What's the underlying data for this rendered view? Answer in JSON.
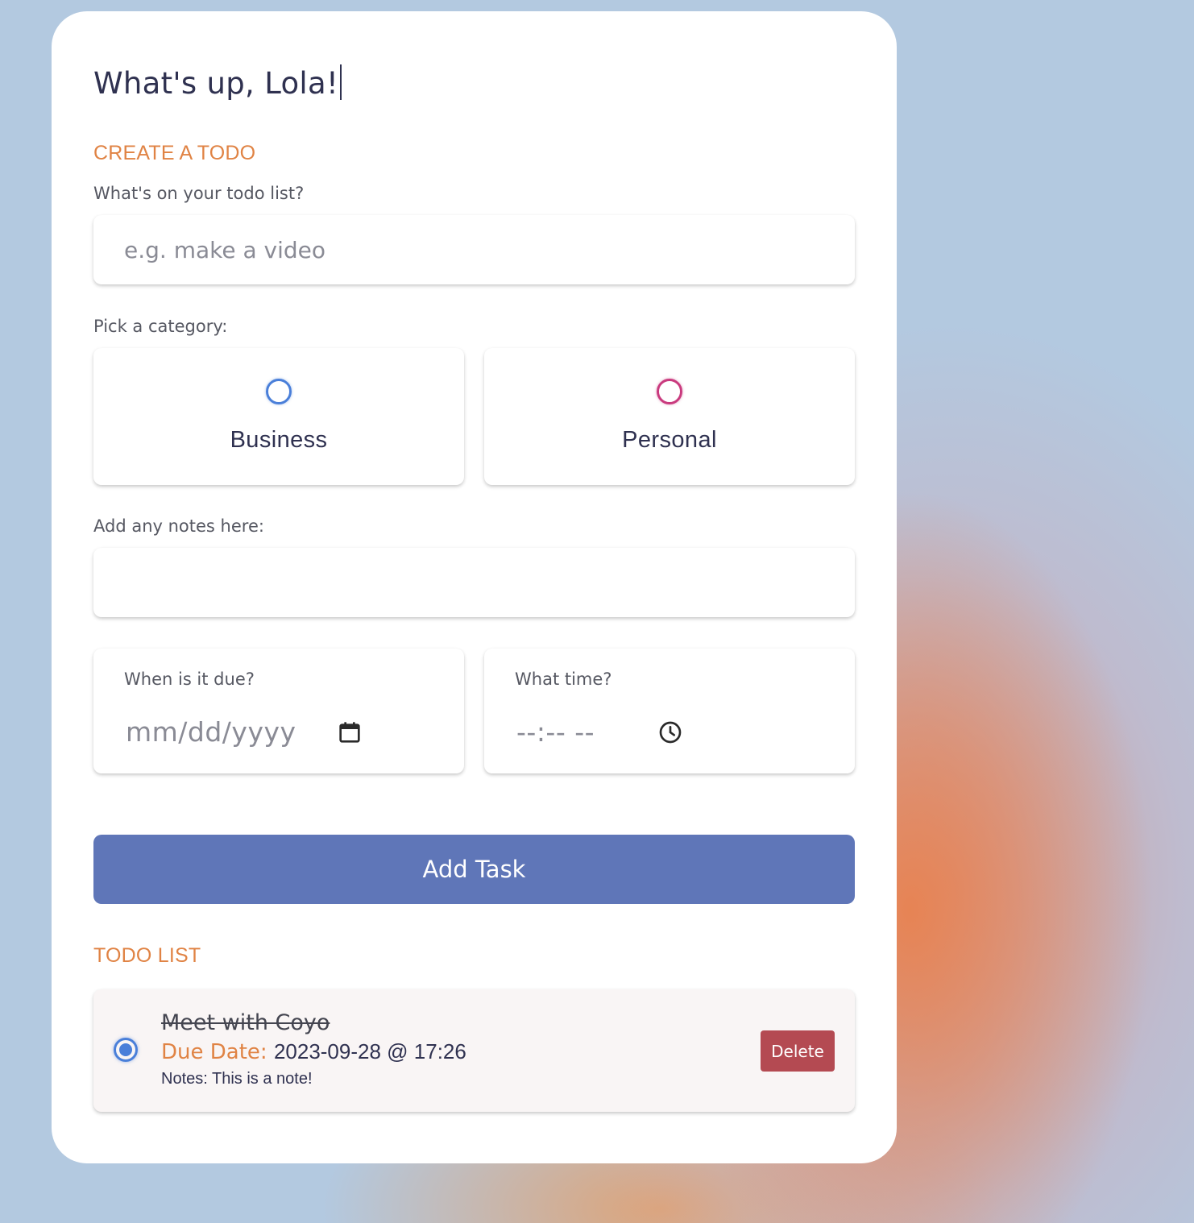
{
  "greeting": {
    "prefix": "What's up, ",
    "name": "Lola!"
  },
  "create": {
    "heading": "CREATE A TODO",
    "task_label": "What's on your todo list?",
    "task_placeholder": "e.g. make a video",
    "category_label": "Pick a category:",
    "categories": [
      {
        "label": "Business",
        "color": "#4a7fd9",
        "selected": false
      },
      {
        "label": "Personal",
        "color": "#c93a7e",
        "selected": false
      }
    ],
    "notes_label": "Add any notes here:",
    "notes_value": "",
    "date_label": "When is it due?",
    "date_value": "mm/dd/yyyy",
    "date_icon": "calendar-icon",
    "time_label": "What time?",
    "time_value": "--:-- --",
    "time_icon": "clock-icon",
    "submit_label": "Add Task"
  },
  "list": {
    "heading": "TODO LIST",
    "items": [
      {
        "title": "Meet with Coyo",
        "done": true,
        "due_label": "Due Date:",
        "due_value": "2023-09-28 @ 17:26",
        "notes": "Notes: This is a note!",
        "delete_label": "Delete"
      }
    ]
  },
  "colors": {
    "accent_orange": "#e08344",
    "primary_button": "#5f76b8",
    "delete_button": "#b44a52",
    "text_dark": "#2f3150"
  }
}
